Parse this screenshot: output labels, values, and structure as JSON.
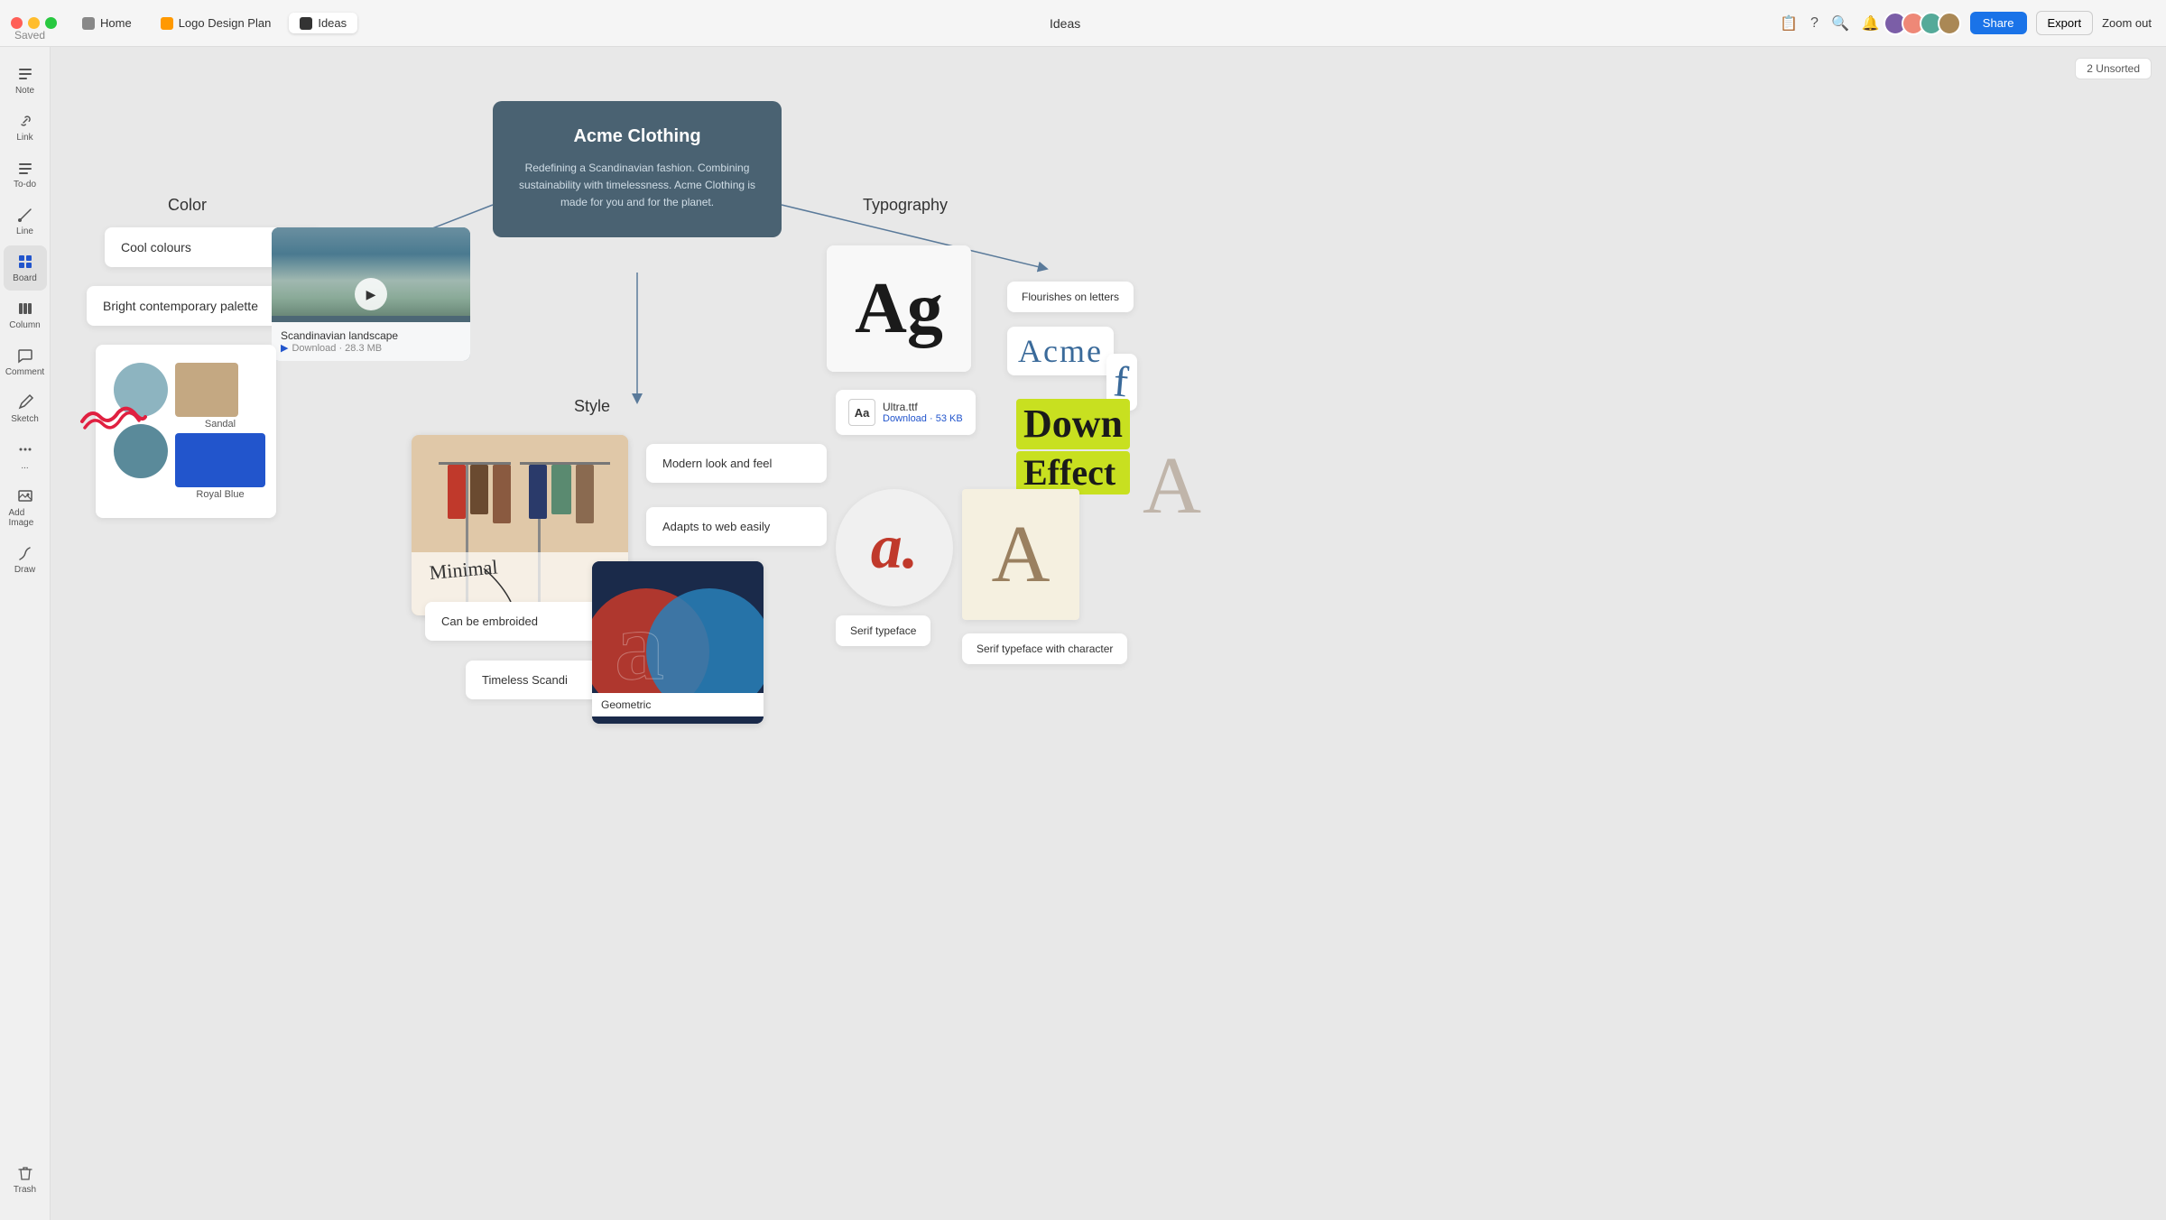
{
  "app": {
    "title": "Ideas",
    "saved_label": "Saved"
  },
  "tabs": [
    {
      "id": "home",
      "label": "Home",
      "icon_color": "#888888",
      "active": false
    },
    {
      "id": "logo",
      "label": "Logo Design Plan",
      "icon_color": "#ff9900",
      "active": false
    },
    {
      "id": "ideas",
      "label": "Ideas",
      "icon_color": "#333333",
      "active": true
    }
  ],
  "topbar": {
    "title": "Ideas",
    "share_label": "Share",
    "export_label": "Export",
    "zoom_label": "Zoom out",
    "unsorted_label": "2 Unsorted"
  },
  "sidebar": {
    "items": [
      {
        "id": "note",
        "label": "Note",
        "icon": "≡"
      },
      {
        "id": "link",
        "label": "Link",
        "icon": "🔗"
      },
      {
        "id": "todo",
        "label": "To-do",
        "icon": "☰"
      },
      {
        "id": "line",
        "label": "Line",
        "icon": "✏"
      },
      {
        "id": "board",
        "label": "Board",
        "icon": "⊞",
        "active": true
      },
      {
        "id": "column",
        "label": "Column",
        "icon": "║"
      },
      {
        "id": "comment",
        "label": "Comment",
        "icon": "💬"
      },
      {
        "id": "sketch",
        "label": "Sketch",
        "icon": "✐"
      },
      {
        "id": "more",
        "label": "...",
        "icon": "•••"
      },
      {
        "id": "add-image",
        "label": "Add Image",
        "icon": "+"
      },
      {
        "id": "draw",
        "label": "Draw",
        "icon": "✏"
      }
    ],
    "trash_label": "Trash"
  },
  "canvas": {
    "central_card": {
      "title": "Acme Clothing",
      "description": "Redefining a Scandinavian fashion. Combining sustainability with timelessness. Acme Clothing is made for you and for the planet."
    },
    "sections": [
      {
        "id": "color",
        "label": "Color"
      },
      {
        "id": "style",
        "label": "Style"
      },
      {
        "id": "typography",
        "label": "Typography"
      }
    ],
    "color_section": {
      "note1": "Cool colours",
      "note2": "Bright contemporary palette",
      "video": {
        "title": "Scandinavian landscape",
        "subtitle": "Download · 28.3 MB"
      },
      "swatches": [
        {
          "id": "circle1",
          "color": "#8db4c0",
          "shape": "circle"
        },
        {
          "id": "circle2",
          "color": "#5a8a9a",
          "shape": "circle"
        },
        {
          "id": "rect-tan",
          "color": "#c4a882",
          "label": "Sandal",
          "shape": "rect"
        },
        {
          "id": "rect-blue",
          "color": "#2255cc",
          "label": "Royal Blue",
          "shape": "rect"
        }
      ]
    },
    "style_section": {
      "notes": [
        {
          "id": "modern",
          "text": "Modern look and feel"
        },
        {
          "id": "adapts",
          "text": "Adapts to web easily"
        },
        {
          "id": "embroider",
          "text": "Can be embroided"
        },
        {
          "id": "timeless",
          "text": "Timeless Scandi"
        }
      ],
      "geometric_label": "Geometric"
    },
    "typography_section": {
      "flourish_label": "Flourishes on letters",
      "ultra_label": "Ultra.ttf",
      "ultra_download": "Download · 53 KB",
      "serif_label": "Serif typeface",
      "serif_char_label": "Serif typeface with character"
    }
  }
}
